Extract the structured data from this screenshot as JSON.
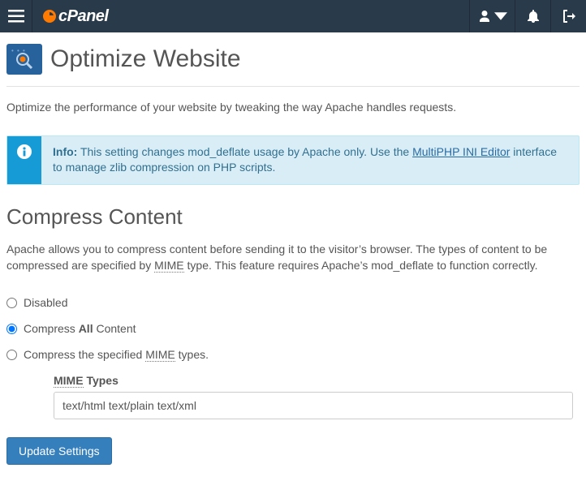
{
  "nav": {
    "brand": "cPanel"
  },
  "page": {
    "title": "Optimize Website",
    "description": "Optimize the performance of your website by tweaking the way Apache handles requests."
  },
  "callout": {
    "label": "Info:",
    "text_before": " This setting changes mod_deflate usage by Apache only. Use the ",
    "link_text": "MultiPHP INI Editor",
    "text_after": " interface to manage zlib compression on PHP scripts."
  },
  "section": {
    "title": "Compress Content",
    "desc_1": "Apache allows you to compress content before sending it to the visitor’s browser. The types of content to be compressed are specified by ",
    "mime_abbr": "MIME",
    "desc_2": " type. This feature requires Apache’s mod_deflate to function correctly."
  },
  "options": {
    "disabled": "Disabled",
    "all_pre": "Compress ",
    "all_bold": "All",
    "all_post": " Content",
    "specified_pre": "Compress the specified ",
    "specified_post": " types.",
    "mime_types_label_pre": "MIME",
    "mime_types_label_post": " Types",
    "mime_input_value": "text/html text/plain text/xml"
  },
  "actions": {
    "update": "Update Settings"
  }
}
